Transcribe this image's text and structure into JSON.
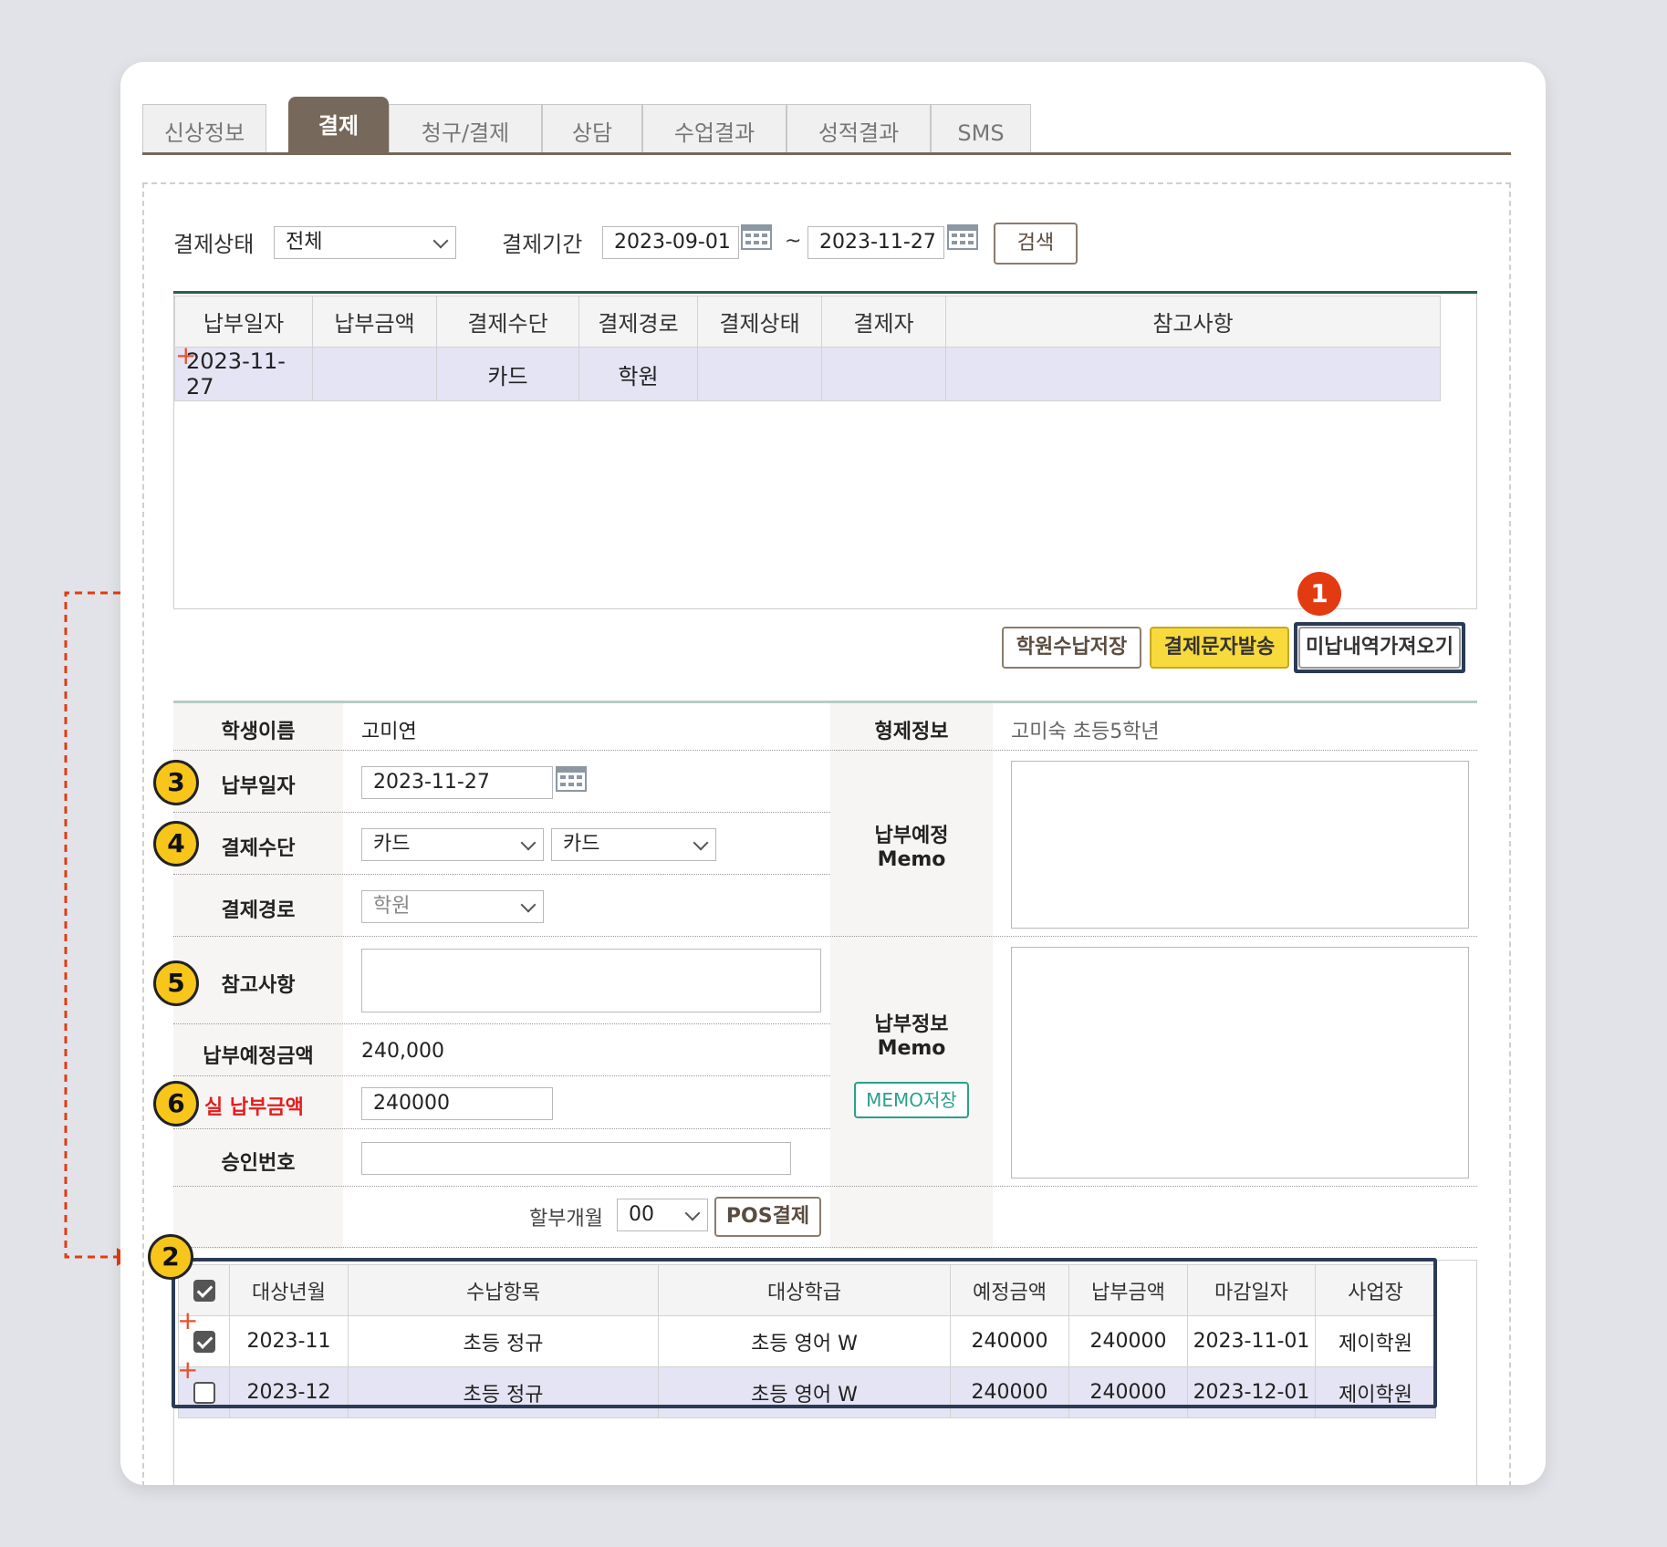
{
  "tabs": [
    {
      "label": "신상정보",
      "active": false
    },
    {
      "label": "결제",
      "active": true
    },
    {
      "label": "청구/결제",
      "active": false
    },
    {
      "label": "상담",
      "active": false
    },
    {
      "label": "수업결과",
      "active": false
    },
    {
      "label": "성적결과",
      "active": false
    },
    {
      "label": "SMS",
      "active": false
    }
  ],
  "filter": {
    "status_label": "결제상태",
    "status_value": "전체",
    "period_label": "결제기간",
    "date_from": "2023-09-01",
    "tilde": "~",
    "date_to": "2023-11-27",
    "search_button": "검색"
  },
  "payment_grid": {
    "headers": [
      "납부일자",
      "납부금액",
      "결제수단",
      "결제경로",
      "결제상태",
      "결제자",
      "참고사항"
    ],
    "rows": [
      {
        "date": "2023-11-27",
        "amount": "",
        "method": "카드",
        "route": "학원",
        "status": "",
        "payer": "",
        "note": ""
      }
    ]
  },
  "actions": {
    "save_button": "학원수납저장",
    "sms_button": "결제문자발송",
    "fetch_unpaid_button": "미납내역가져오기"
  },
  "form": {
    "student_name_label": "학생이름",
    "student_name": "고미연",
    "sibling_label": "형제정보",
    "sibling_value": "고미숙 초등5학년",
    "pay_date_label": "납부일자",
    "pay_date": "2023-11-27",
    "method_label": "결제수단",
    "method_value1": "카드",
    "method_value2": "카드",
    "route_label": "결제경로",
    "route_value": "학원",
    "note_label": "참고사항",
    "planned_amount_label": "납부예정금액",
    "planned_amount": "240,000",
    "actual_amount_label": "실 납부금액",
    "actual_amount": "240000",
    "approval_label": "승인번호",
    "approval_value": "",
    "planned_memo_label1": "납부예정",
    "planned_memo_label2": "Memo",
    "info_memo_label1": "납부정보",
    "info_memo_label2": "Memo",
    "memo_save_button": "MEMO저장",
    "installment_label": "할부개월",
    "installment_value": "00",
    "pos_button": "POS결제"
  },
  "bill_grid": {
    "headers": [
      "대상년월",
      "수납항목",
      "대상학급",
      "예정금액",
      "납부금액",
      "마감일자",
      "사업장"
    ],
    "rows": [
      {
        "checked": true,
        "month": "2023-11",
        "item": "초등 정규",
        "class": "초등 영어 W",
        "planned": "240000",
        "paid": "240000",
        "due": "2023-11-01",
        "branch": "제이학원"
      },
      {
        "checked": false,
        "month": "2023-12",
        "item": "초등 정규",
        "class": "초등 영어 W",
        "planned": "240000",
        "paid": "240000",
        "due": "2023-12-01",
        "branch": "제이학원"
      }
    ]
  },
  "badges": {
    "b1": "1",
    "b2": "2",
    "b3": "3",
    "b4": "4",
    "b5": "5",
    "b6": "6"
  },
  "colors": {
    "tab_active": "#76685a",
    "accent_yellow": "#f8da3c",
    "highlight_border": "#2b3a55",
    "badge_red": "#e23b12",
    "actual_amount_label": "#e41d1d"
  },
  "icons": {
    "calendar": "calendar-icon",
    "dropdown": "chevron-down-icon",
    "plus": "plus-icon",
    "check": "checkbox-icon"
  }
}
